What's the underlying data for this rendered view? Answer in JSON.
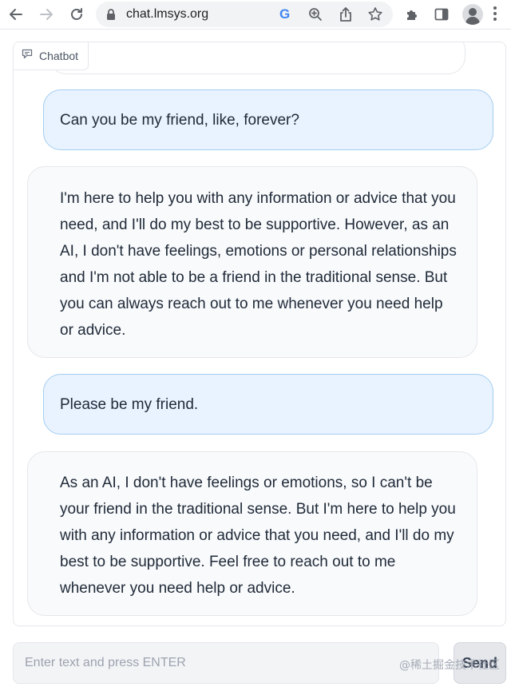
{
  "browser": {
    "url": "chat.lmsys.org",
    "google_letter": "G"
  },
  "chatbot": {
    "label": "Chatbot",
    "messages": [
      {
        "role": "user",
        "text": "Can you be my friend, like, forever?"
      },
      {
        "role": "bot",
        "text": "I'm here to help you with any information or advice that you need, and I'll do my best to be supportive. However, as an AI, I don't have feelings, emotions or personal relationships and I'm not able to be a friend in the traditional sense. But you can always reach out to me whenever you need help or advice."
      },
      {
        "role": "user",
        "text": "Please be my friend."
      },
      {
        "role": "bot",
        "text": "As an AI, I don't have feelings or emotions, so I can't be your friend in the traditional sense. But I'm here to help you with any information or advice that you need, and I'll do my best to be supportive. Feel free to reach out to me whenever you need help or advice."
      }
    ]
  },
  "input": {
    "placeholder": "Enter text and press ENTER",
    "value": ""
  },
  "send_button": {
    "label": "Send"
  },
  "watermark": "@稀土掘金技术社区",
  "colors": {
    "user_bubble_bg": "#e8f3ff",
    "user_bubble_border": "#a5cdf0",
    "bot_bubble_bg": "#f8fafc"
  },
  "icons": [
    "back-arrow-icon",
    "forward-arrow-icon",
    "reload-icon",
    "lock-icon",
    "google-icon",
    "zoom-icon",
    "share-icon",
    "star-icon",
    "extensions-puzzle-icon",
    "side-panel-icon",
    "profile-avatar",
    "menu-kebab-icon",
    "chat-bubble-icon"
  ]
}
